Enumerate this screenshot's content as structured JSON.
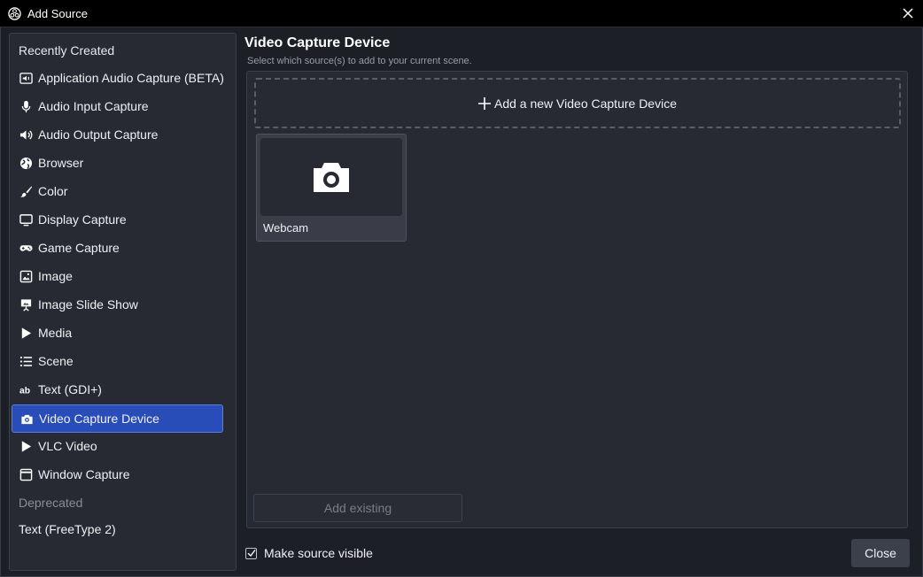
{
  "window": {
    "title": "Add Source",
    "colors": {
      "accent": "#284cb8",
      "background": "#1d1f26",
      "panel": "#272a33"
    }
  },
  "sidebar": {
    "recent_heading": "Recently Created",
    "items": [
      {
        "label": "Application Audio Capture (BETA)",
        "icon": "app-audio-icon"
      },
      {
        "label": "Audio Input Capture",
        "icon": "microphone-icon"
      },
      {
        "label": "Audio Output Capture",
        "icon": "speaker-icon"
      },
      {
        "label": "Browser",
        "icon": "globe-icon"
      },
      {
        "label": "Color",
        "icon": "brush-icon"
      },
      {
        "label": "Display Capture",
        "icon": "monitor-icon"
      },
      {
        "label": "Game Capture",
        "icon": "gamepad-icon"
      },
      {
        "label": "Image",
        "icon": "image-icon"
      },
      {
        "label": "Image Slide Show",
        "icon": "slideshow-icon"
      },
      {
        "label": "Media",
        "icon": "play-icon"
      },
      {
        "label": "Scene",
        "icon": "list-icon"
      },
      {
        "label": "Text (GDI+)",
        "icon": "text-icon"
      },
      {
        "label": "Video Capture Device",
        "icon": "camera-icon",
        "selected": true
      },
      {
        "label": "VLC Video",
        "icon": "play-icon"
      },
      {
        "label": "Window Capture",
        "icon": "window-icon"
      }
    ],
    "deprecated_heading": "Deprecated",
    "deprecated_items": [
      {
        "label": "Text (FreeType 2)"
      }
    ]
  },
  "main": {
    "title": "Video Capture Device",
    "subtitle": "Select which source(s) to add to your current scene.",
    "add_new_label": "Add a new Video Capture Device",
    "existing_sources": [
      {
        "label": "Webcam",
        "icon": "camera-icon"
      }
    ],
    "add_existing_label": "Add existing"
  },
  "footer": {
    "make_visible_label": "Make source visible",
    "make_visible_checked": true,
    "close_label": "Close"
  }
}
